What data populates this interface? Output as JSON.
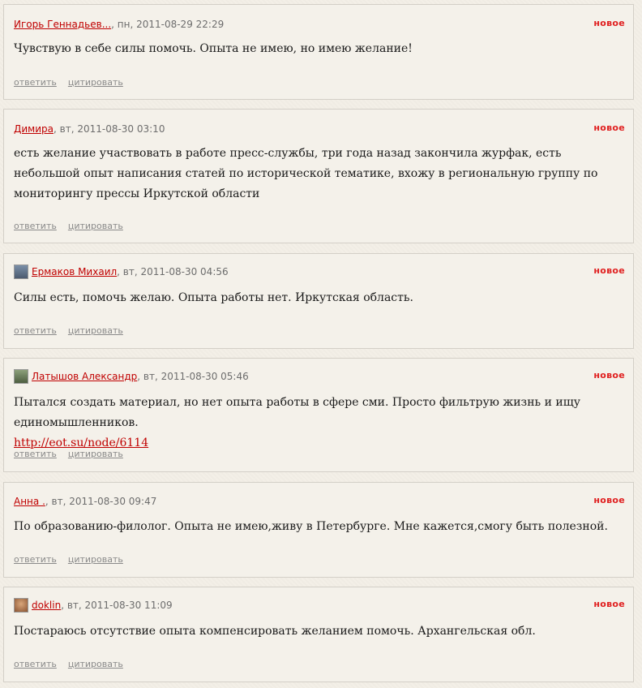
{
  "new_label": "новое",
  "reply_label": "ответить",
  "quote_label": "цитировать",
  "comments": [
    {
      "author": "Игорь Геннадьев...",
      "meta": ", пн, 2011-08-29 22:29",
      "text": "Чувствую в себе силы помочь. Опыта не имею, но имею желание!"
    },
    {
      "author": "Димира",
      "meta": ", вт, 2011-08-30 03:10",
      "text": "есть желание участвовать в работе пресс-службы, три года назад закончила журфак, есть небольшой опыт написания статей по исторической тематике, вхожу в региональную группу по мониторингу прессы Иркутской области"
    },
    {
      "author": "Ермаков Михаил",
      "meta": ", вт, 2011-08-30 04:56",
      "text": "Силы есть, помочь желаю. Опыта работы нет. Иркутская область."
    },
    {
      "author": "Латышов Александр",
      "meta": ", вт, 2011-08-30 05:46",
      "text": "Пытался создать материал, но нет опыта работы в сфере сми. Просто фильтрую жизнь и ищу единомышленников.",
      "link": "http://eot.su/node/6114"
    },
    {
      "author": "Анна .",
      "meta": ", вт, 2011-08-30 09:47",
      "text": "По образованию-филолог. Опыта не имею,живу в Петербурге. Мне кажется,смогу быть полезной."
    },
    {
      "author": "doklin",
      "meta": ", вт, 2011-08-30 11:09",
      "text": "Постараюсь отсутствие опыта компенсировать желанием помочь. Архангельская обл."
    }
  ]
}
